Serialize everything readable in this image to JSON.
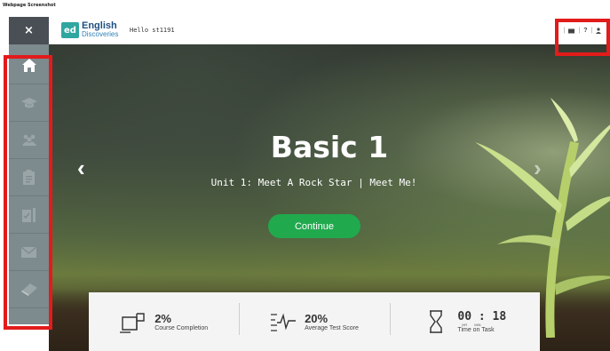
{
  "caption": "Webpage Screenshot",
  "header": {
    "close_label": "×",
    "logo_mark": "ed",
    "logo_line1": "English",
    "logo_line2": "Discoveries",
    "greeting": "Hello st1191",
    "separator": "|",
    "help_label": "?"
  },
  "sidebar": {
    "items": [
      {
        "icon": "home-icon",
        "active": true
      },
      {
        "icon": "graduation-cap-icon",
        "active": false
      },
      {
        "icon": "group-icon",
        "active": false
      },
      {
        "icon": "clipboard-icon",
        "active": false
      },
      {
        "icon": "assignment-icon",
        "active": false
      },
      {
        "icon": "envelope-icon",
        "active": false
      },
      {
        "icon": "book-icon",
        "active": false
      }
    ]
  },
  "hero": {
    "title": "Basic 1",
    "subtitle": "Unit 1: Meet A Rock Star | Meet Me!",
    "continue_label": "Continue",
    "prev_arrow": "‹",
    "next_arrow": "›"
  },
  "stats": {
    "course_completion": {
      "value": "2%",
      "label": "Course Completion"
    },
    "average_test_score": {
      "value": "20%",
      "label": "Average Test Score"
    },
    "time_on_task": {
      "value": "00 : 18",
      "unit_hr": "HR",
      "unit_min": "MIN",
      "label": "Time on Task"
    }
  },
  "colors": {
    "continue_button": "#21a94e",
    "sidebar": "#7d8a8e",
    "header_close": "#4a4e55",
    "highlight": "#e21b1b"
  }
}
